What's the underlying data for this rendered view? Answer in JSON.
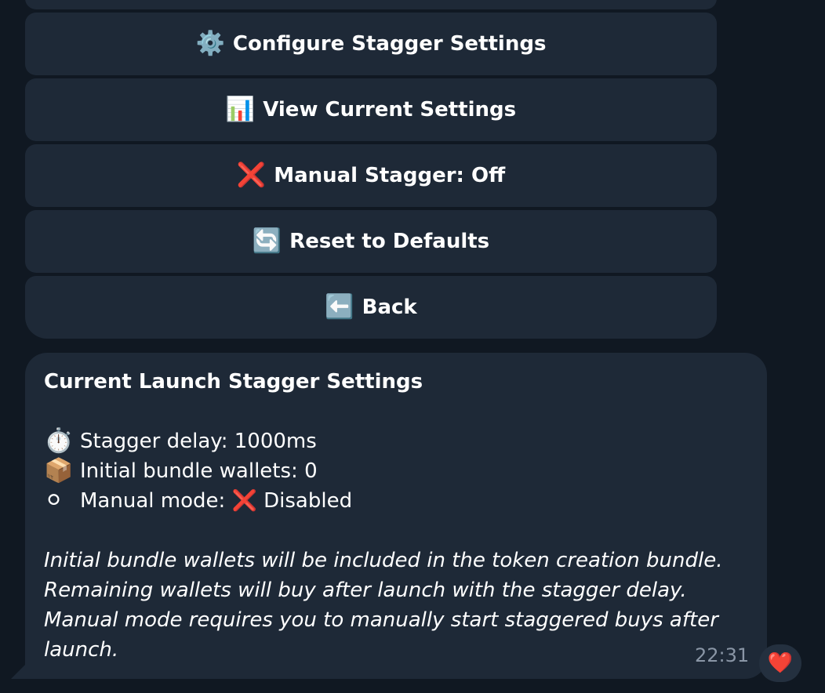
{
  "keyboard": {
    "buttons": [
      {
        "icon": "⚙️",
        "label": "Configure Stagger Settings"
      },
      {
        "icon": "📊",
        "label": "View Current Settings"
      },
      {
        "icon": "❌",
        "label": "Manual Stagger: Off"
      },
      {
        "icon": "🔄",
        "label": "Reset to Defaults"
      },
      {
        "icon": "⬅️",
        "label": "Back"
      }
    ]
  },
  "message": {
    "title": "Current Launch Stagger Settings",
    "lines": [
      {
        "icon": "⏱️",
        "text": "Stagger delay: 1000ms"
      },
      {
        "icon": "📦",
        "text": "Initial bundle wallets: 0"
      },
      {
        "icon": "⚪",
        "text": "Manual mode: ❌ Disabled"
      }
    ],
    "notes": [
      "Initial bundle wallets will be included in the token creation bundle.",
      "Remaining wallets will buy after launch with the stagger delay.",
      "Manual mode requires you to manually start staggered buys after",
      "launch."
    ],
    "time": "22:31",
    "reaction": "❤️"
  }
}
